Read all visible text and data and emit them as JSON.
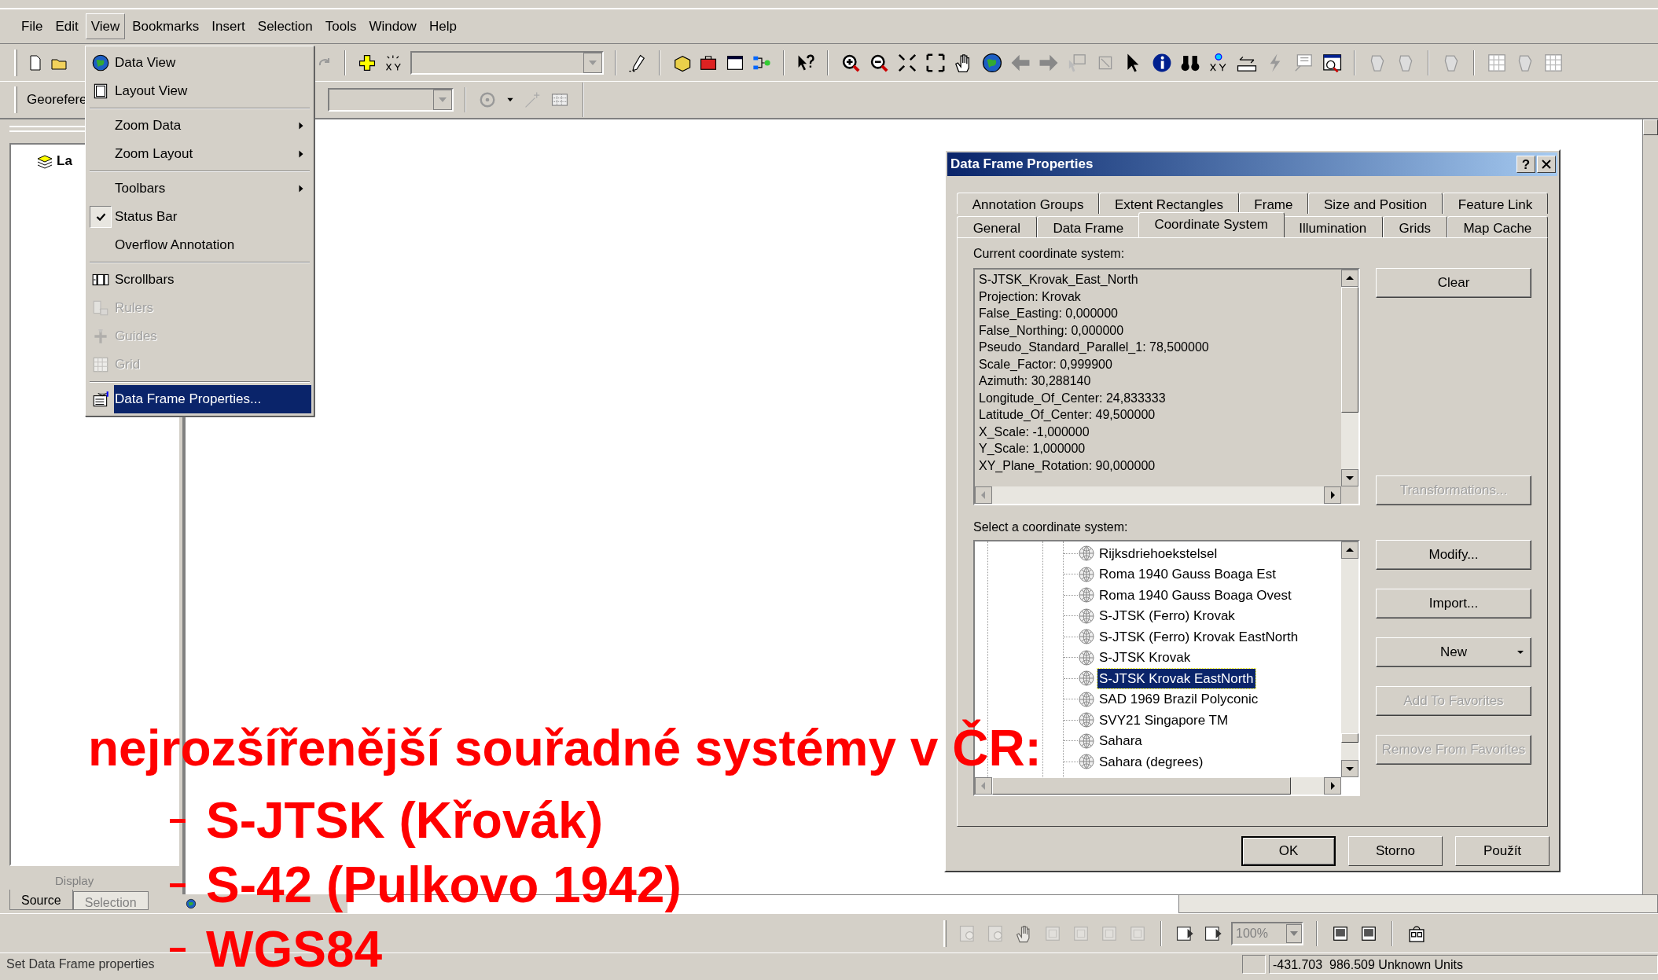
{
  "menu_bar": [
    {
      "label": "File",
      "selected": false
    },
    {
      "label": "Edit",
      "selected": false
    },
    {
      "label": "View",
      "selected": true
    },
    {
      "label": "Bookmarks",
      "selected": false
    },
    {
      "label": "Insert",
      "selected": false
    },
    {
      "label": "Selection",
      "selected": false
    },
    {
      "label": "Tools",
      "selected": false
    },
    {
      "label": "Window",
      "selected": false
    },
    {
      "label": "Help",
      "selected": false
    }
  ],
  "georeferencing_toolbar": {
    "label": "Georefere"
  },
  "view_menu": [
    {
      "kind": "item",
      "label": "Data View",
      "checked": false,
      "disabled": false,
      "selected": false,
      "submenu": false
    },
    {
      "kind": "item",
      "label": "Layout View",
      "checked": false,
      "disabled": false,
      "selected": false,
      "submenu": false
    },
    {
      "kind": "separator"
    },
    {
      "kind": "item",
      "label": "Zoom Data",
      "checked": false,
      "disabled": false,
      "selected": false,
      "submenu": true
    },
    {
      "kind": "item",
      "label": "Zoom Layout",
      "checked": false,
      "disabled": false,
      "selected": false,
      "submenu": true
    },
    {
      "kind": "separator"
    },
    {
      "kind": "item",
      "label": "Toolbars",
      "checked": false,
      "disabled": false,
      "selected": false,
      "submenu": true
    },
    {
      "kind": "item",
      "label": "Status Bar",
      "checked": true,
      "disabled": false,
      "selected": false,
      "submenu": false
    },
    {
      "kind": "item",
      "label": "Overflow Annotation",
      "checked": false,
      "disabled": false,
      "selected": false,
      "submenu": false
    },
    {
      "kind": "separator"
    },
    {
      "kind": "item",
      "label": "Scrollbars",
      "checked": false,
      "disabled": false,
      "selected": false,
      "submenu": false
    },
    {
      "kind": "item",
      "label": "Rulers",
      "checked": false,
      "disabled": true,
      "selected": false,
      "submenu": false
    },
    {
      "kind": "item",
      "label": "Guides",
      "checked": false,
      "disabled": true,
      "selected": false,
      "submenu": false
    },
    {
      "kind": "item",
      "label": "Grid",
      "checked": false,
      "disabled": true,
      "selected": false,
      "submenu": false
    },
    {
      "kind": "separator"
    },
    {
      "kind": "item",
      "label": "Data Frame Properties...",
      "checked": false,
      "disabled": false,
      "selected": true,
      "submenu": false
    }
  ],
  "toc": {
    "layers_label": "La",
    "display_label": "Display",
    "tabs": [
      {
        "label": "Source",
        "selected": true
      },
      {
        "label": "Selection",
        "selected": false
      }
    ]
  },
  "dialog": {
    "title": "Data Frame Properties",
    "help_button": "?",
    "tab_rows": [
      {
        "tabs": [
          {
            "label": "Annotation Groups",
            "selected": false
          },
          {
            "label": "Extent Rectangles",
            "selected": false
          },
          {
            "label": "Frame",
            "selected": false
          },
          {
            "label": "Size and Position",
            "selected": false
          },
          {
            "label": "Feature Link",
            "selected": false
          }
        ]
      },
      {
        "tabs": [
          {
            "label": "General",
            "selected": false
          },
          {
            "label": "Data Frame",
            "selected": false
          },
          {
            "label": "Coordinate System",
            "selected": true
          },
          {
            "label": "Illumination",
            "selected": false
          },
          {
            "label": "Grids",
            "selected": false
          },
          {
            "label": "Map Cache",
            "selected": false
          }
        ]
      }
    ],
    "current_label": "Current coordinate system:",
    "current_lines": [
      "S-JTSK_Krovak_East_North",
      "Projection: Krovak",
      "False_Easting: 0,000000",
      "False_Northing: 0,000000",
      "Pseudo_Standard_Parallel_1: 78,500000",
      "Scale_Factor: 0,999900",
      "Azimuth: 30,288140",
      "Longitude_Of_Center: 24,833333",
      "Latitude_Of_Center: 49,500000",
      "X_Scale: -1,000000",
      "Y_Scale: 1,000000",
      "XY_Plane_Rotation: 90,000000"
    ],
    "clear_button": {
      "label": "Clear",
      "disabled": false
    },
    "transformations_button": {
      "label": "Transformations...",
      "disabled": true
    },
    "select_label": "Select a coordinate system:",
    "tree_items": [
      {
        "label": "Rijksdriehoekstelsel",
        "selected": false
      },
      {
        "label": "Roma 1940 Gauss Boaga Est",
        "selected": false
      },
      {
        "label": "Roma 1940 Gauss Boaga Ovest",
        "selected": false
      },
      {
        "label": "S-JTSK (Ferro) Krovak",
        "selected": false
      },
      {
        "label": "S-JTSK (Ferro) Krovak EastNorth",
        "selected": false
      },
      {
        "label": "S-JTSK Krovak",
        "selected": false
      },
      {
        "label": "S-JTSK Krovak EastNorth",
        "selected": true
      },
      {
        "label": "SAD 1969 Brazil Polyconic",
        "selected": false
      },
      {
        "label": "SVY21 Singapore TM",
        "selected": false
      },
      {
        "label": "Sahara",
        "selected": false
      },
      {
        "label": "Sahara (degrees)",
        "selected": false
      }
    ],
    "side_buttons": [
      {
        "kind": "plain",
        "label": "Modify...",
        "disabled": false
      },
      {
        "kind": "plain",
        "label": "Import...",
        "disabled": false
      },
      {
        "kind": "dropdown",
        "label": "New",
        "disabled": false
      },
      {
        "kind": "plain",
        "label": "Add To Favorites",
        "disabled": true
      },
      {
        "kind": "plain",
        "label": "Remove From Favorites",
        "disabled": true
      }
    ],
    "footer_buttons": [
      {
        "label": "OK",
        "default": true
      },
      {
        "label": "Storno",
        "default": false
      },
      {
        "label": "Použít",
        "default": false
      }
    ]
  },
  "zoom_combo": {
    "value": "100%",
    "disabled": true
  },
  "status_bar": {
    "message": "Set Data Frame properties",
    "coordinates": "-431.703  986.509 Unknown Units"
  },
  "overlay": {
    "heading": "nejrozšířenější souřadné systémy v ČR:",
    "items": [
      "S-JTSK (Křovák)",
      "S-42 (Pulkovo 1942)",
      "WGS84"
    ]
  }
}
